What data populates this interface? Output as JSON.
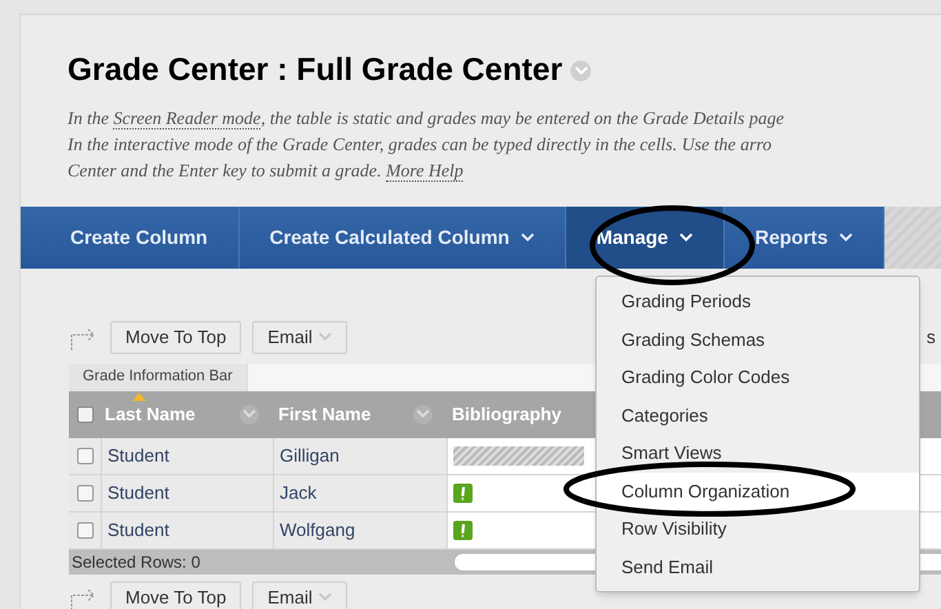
{
  "title": "Grade Center : Full Grade Center",
  "description": [
    {
      "parts": [
        {
          "text": "In the "
        },
        {
          "text": "Screen Reader mode",
          "link": true
        },
        {
          "text": ", the table is static and grades may be entered on the Grade Details page"
        }
      ]
    },
    {
      "parts": [
        {
          "text": "In the interactive mode of the Grade Center, grades can be typed directly in the cells. Use the arro"
        }
      ]
    },
    {
      "parts": [
        {
          "text": "Center and the Enter key to submit a grade. "
        },
        {
          "text": "More Help",
          "link": true
        }
      ]
    }
  ],
  "nav": [
    {
      "label": "Create Column",
      "dropdown": false,
      "selected": false
    },
    {
      "label": "Create Calculated Column",
      "dropdown": true,
      "selected": false
    },
    {
      "label": "Manage",
      "dropdown": true,
      "selected": true
    },
    {
      "label": "Reports",
      "dropdown": true,
      "selected": false
    }
  ],
  "menu": [
    {
      "label": "Grading Periods",
      "selected": false
    },
    {
      "label": "Grading Schemas",
      "selected": false
    },
    {
      "label": "Grading Color Codes",
      "selected": false
    },
    {
      "label": "Categories",
      "selected": false
    },
    {
      "label": "Smart Views",
      "selected": false
    },
    {
      "label": "Column Organization",
      "selected": true
    },
    {
      "label": "Row Visibility",
      "selected": false
    },
    {
      "label": "Send Email",
      "selected": false
    }
  ],
  "action_buttons": [
    "Move To Top",
    "Email"
  ],
  "side_text": "s",
  "info_bar": "Grade Information Bar",
  "header_checked": false,
  "columns": [
    {
      "label": "Last Name",
      "sorted": true
    },
    {
      "label": "First Name",
      "sorted": false
    },
    {
      "label": "Bibliography",
      "sorted": false
    }
  ],
  "rows": [
    {
      "last": "Student",
      "first": "Gilligan",
      "checked": false,
      "kind": "progress"
    },
    {
      "last": "Student",
      "first": "Jack",
      "checked": false,
      "kind": "attention"
    },
    {
      "last": "Student",
      "first": "Wolfgang",
      "checked": false,
      "kind": "attention"
    }
  ],
  "selected_rows": "Selected Rows: 0",
  "bottom_buttons": [
    "Move To Top",
    "Email"
  ]
}
